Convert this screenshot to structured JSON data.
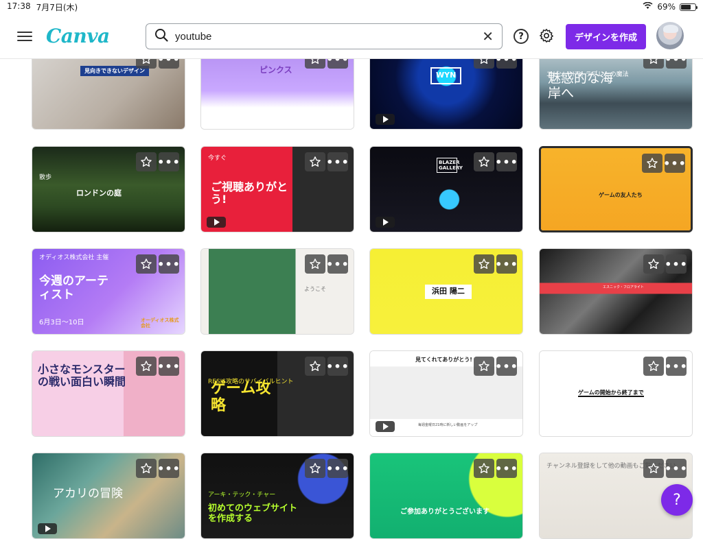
{
  "status_bar": {
    "time": "17:38",
    "date": "7月7日(木)",
    "battery_pct": "69%",
    "battery_level": 0.69
  },
  "header": {
    "logo": "Canva",
    "search_value": "youtube",
    "create_button": "デザインを作成",
    "help_label": "?"
  },
  "fab_label": "?",
  "colors": {
    "accent": "#7d2ae8",
    "logo": "#1fb7c9"
  },
  "templates": [
    {
      "title": "見向きできないデザイン",
      "theme": "laptop-desk"
    },
    {
      "title": "ピンクス",
      "theme": "purple-cute"
    },
    {
      "title": "WYN",
      "theme": "blue-tech"
    },
    {
      "title": "魅惑的な海岸へ",
      "subtitle": "エピソード3: ラブレーの魔法",
      "theme": "coast"
    },
    {
      "title": "ロンドンの庭",
      "subtitle": "散歩",
      "theme": "garden"
    },
    {
      "title": "ご視聴ありがとう!",
      "subtitle": "今すぐ",
      "theme": "red-thanks"
    },
    {
      "title": "BLAZER GALLERY",
      "theme": "dark-game"
    },
    {
      "title": "ゲームの友人たち",
      "theme": "orange-game"
    },
    {
      "title": "今週のアーティスト",
      "subtitle": "オディオス株式会社 主催",
      "date": "6月3日〜10日",
      "brand": "オーディオス株式会社",
      "theme": "artist"
    },
    {
      "title": "ようこそ",
      "theme": "jungle"
    },
    {
      "title": "浜田 陽二",
      "theme": "yellow-gamepad"
    },
    {
      "title": "エスニック・フロアライト",
      "theme": "skyscraper"
    },
    {
      "title": "小さなモンスターの戦い面白い瞬間",
      "theme": "monster"
    },
    {
      "title": "ゲーム攻略",
      "subtitle": "RESIS攻略のサバイバルヒント",
      "theme": "soldier"
    },
    {
      "title": "見てくれてありがとう!",
      "footer": "毎週金曜日21時に新しい動画をアップ",
      "theme": "player"
    },
    {
      "title": "ゲームの開始から終了まで",
      "theme": "green-gamepad"
    },
    {
      "title": "アカリの冒険",
      "theme": "aerial-beach"
    },
    {
      "title": "初めてのウェブサイトを作成する",
      "subtitle": "アーキ・テック・チャー",
      "theme": "web"
    },
    {
      "title": "ご参加ありがとうございます",
      "theme": "green-thanks"
    },
    {
      "title": "チャンネル登録をして他の動画もご覧ください",
      "theme": "paper"
    }
  ]
}
